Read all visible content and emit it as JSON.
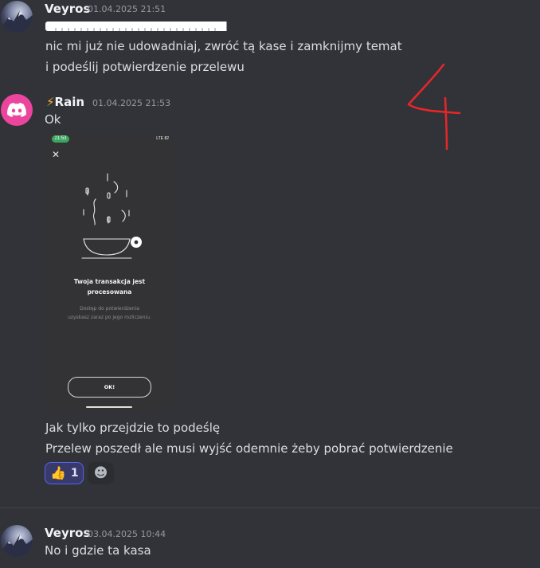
{
  "messages": [
    {
      "author": "Veyros",
      "timestamp": "01.04.2025 21:51",
      "lines": [
        "nic mi już nie udowadniaj, zwróć tą kase i zamknijmy temat",
        "i podeślij potwierdzenie przelewu"
      ]
    },
    {
      "author_prefix": "⚡",
      "author": "Rain",
      "timestamp": "01.04.2025 21:53",
      "lines": [
        "Ok"
      ],
      "attachment": {
        "status_time": "21:53",
        "status_right": "LTE 82",
        "close_symbol": "✕",
        "title": "Twoja transakcja jest\nprocesowana",
        "subtitle": "Dostęp do potwierdzenia\nuzyskasz zaraz po jego rozliczeniu.",
        "ok_label": "OK!"
      },
      "followup_lines": [
        "Jak tylko przejdzie to podeślę",
        "Przelew poszedł ale musi wyjść odemnie żeby pobrać potwierdzenie"
      ],
      "reactions": [
        {
          "emoji": "👍",
          "count": "1",
          "icon": "thumbs-up-icon"
        },
        {
          "emoji": "☻",
          "icon": "add-reaction-icon"
        }
      ]
    },
    {
      "author": "Veyros",
      "timestamp": "03.04.2025 10:44",
      "lines": [
        "No i gdzie ta kasa"
      ]
    }
  ],
  "colors": {
    "background": "#313338",
    "rain_avatar": "#eb459e",
    "reaction_active": "#373a6b",
    "reaction_border": "#5865f2",
    "annotation": "#e8262a"
  }
}
